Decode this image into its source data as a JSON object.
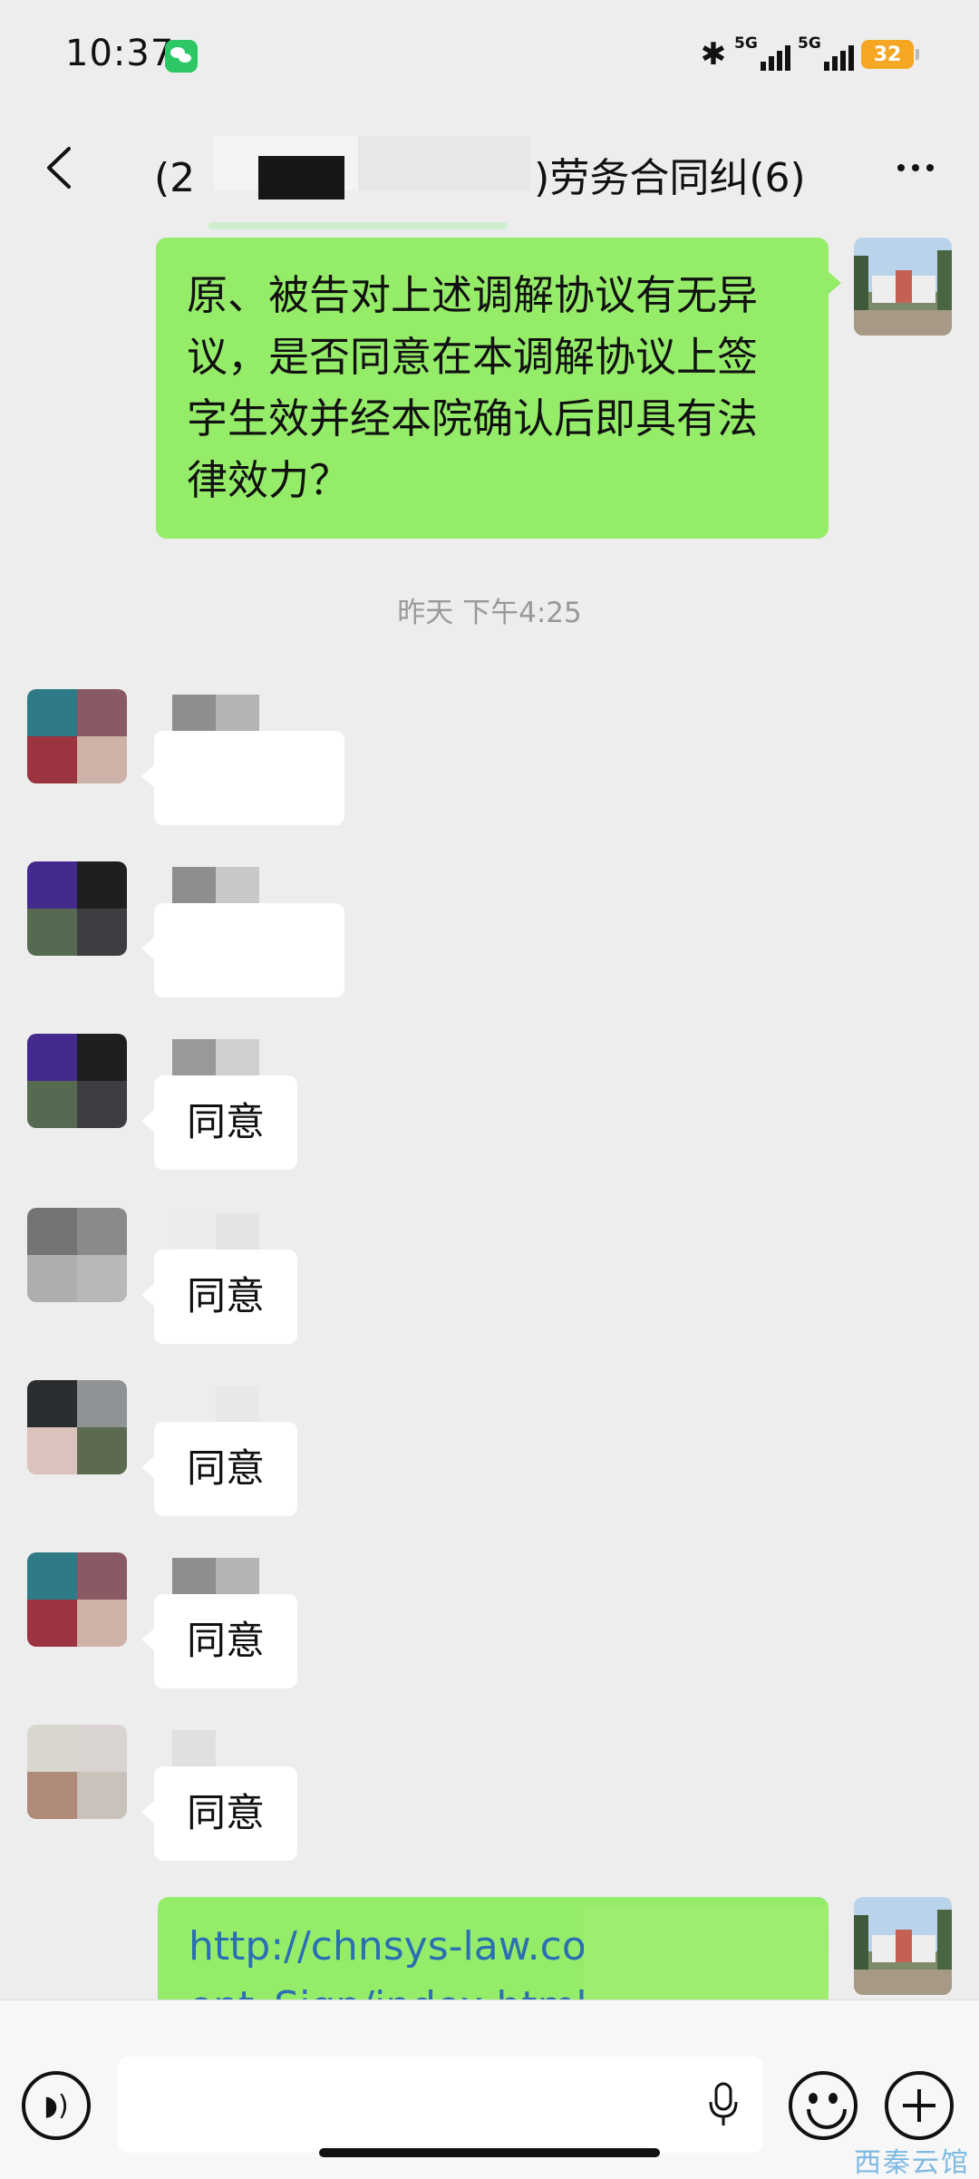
{
  "status_bar": {
    "time": "10:37",
    "network_1": "5G",
    "network_2": "5G",
    "battery": "32",
    "icons": [
      "wechat-icon",
      "bluetooth-icon",
      "signal-icon",
      "battery-icon"
    ]
  },
  "header": {
    "title_prefix": "(2",
    "title_suffix": ")劳务合同纠(6)",
    "back_icon": "chevron-left-icon",
    "more_icon": "more-dots-icon"
  },
  "messages": {
    "outgoing_1": "原、被告对上述调解协议有无异议，是否同意在本调解协议上签字生效并经本院确认后即具有法律效力？",
    "timestamp": "昨天 下午4:25",
    "reply_1": "同意",
    "reply_2": "同意",
    "reply_3": "同意",
    "reply_4": "同意",
    "reply_5": "同意",
    "link_line_1": "http://chnsys-law.com",
    "link_line_2": "ent_Sign/index.html?"
  },
  "input_bar": {
    "voice_icon": "voice-icon",
    "mic_icon": "microphone-icon",
    "emoji_icon": "emoji-icon",
    "plus_icon": "plus-icon"
  },
  "watermark": "西秦云馆",
  "colors": {
    "background": "#ededed",
    "outgoing_bubble": "#95ec69",
    "incoming_bubble": "#ffffff",
    "link": "#2a6fb4",
    "wechat_green": "#2ec766",
    "battery": "#f5a623"
  }
}
